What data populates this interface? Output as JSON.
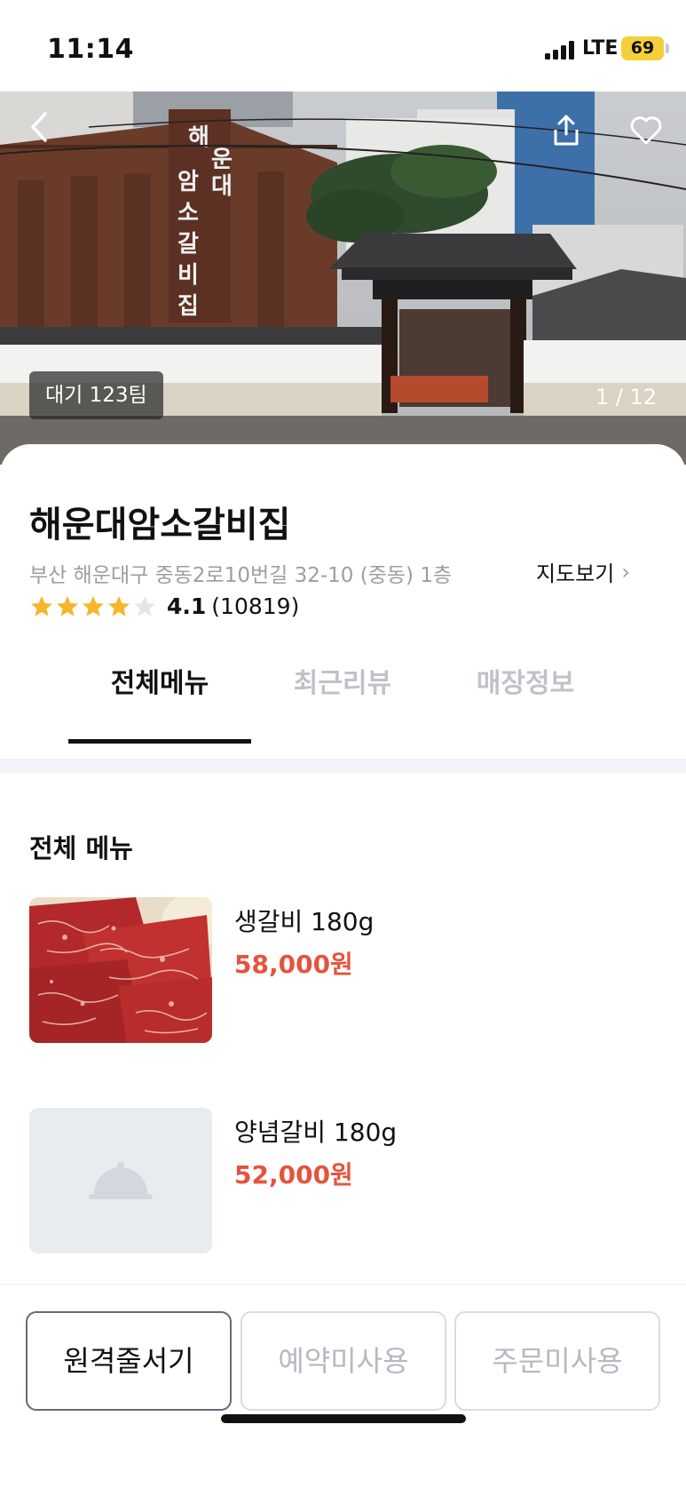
{
  "status_bar": {
    "time": "11:14",
    "network": "LTE",
    "battery": "69"
  },
  "hero": {
    "wait_badge": "대기 123팀",
    "photo_counter": "1 / 12"
  },
  "store": {
    "name": "해운대암소갈비집",
    "address": "부산 해운대구 중동2로10번길 32-10 (중동) 1층",
    "map_link": "지도보기",
    "rating": 4.1,
    "rating_display": "4.1",
    "review_count": "(10819)",
    "star_color": "#f7b52c"
  },
  "tabs": [
    {
      "label": "전체메뉴",
      "active": true
    },
    {
      "label": "최근리뷰",
      "active": false
    },
    {
      "label": "매장정보",
      "active": false
    }
  ],
  "menu": {
    "section_title": "전체 메뉴",
    "items": [
      {
        "name": "생갈비 180g",
        "price": "58,000원",
        "image": "beef-photo"
      },
      {
        "name": "양념갈비 180g",
        "price": "52,000원",
        "image": "placeholder-cloche-icon"
      }
    ],
    "price_color": "#e5533d"
  },
  "actions": {
    "remote_queue": "원격줄서기",
    "reservation": "예약미사용",
    "order": "주문미사용"
  }
}
